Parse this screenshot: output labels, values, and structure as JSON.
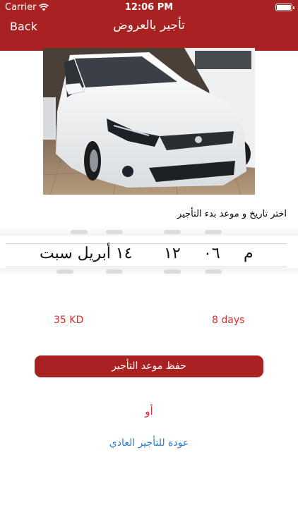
{
  "status_bar": {
    "carrier": "Carrier",
    "time": "12:06 PM",
    "battery_level": 1.0
  },
  "nav": {
    "back": "Back",
    "title": "تأجير بالعروض"
  },
  "prompt": "اختر تاريخ و موعد  بدء التأجير",
  "picker": {
    "date": "١٤ أبريل سبت",
    "hour": "١٢",
    "minute": "٠٦",
    "ampm": "م"
  },
  "prices": {
    "amount": "35 KD",
    "duration": "8 days"
  },
  "save_button": "حفظ موعد التأجير",
  "or_text": "أو",
  "back_normal": "عودة للتأجير العادي",
  "colors": {
    "brand": "#a82222",
    "accent_red": "#d2322d",
    "link_blue": "#2e7dd1"
  },
  "image": {
    "subject": "white sedan car front view"
  }
}
